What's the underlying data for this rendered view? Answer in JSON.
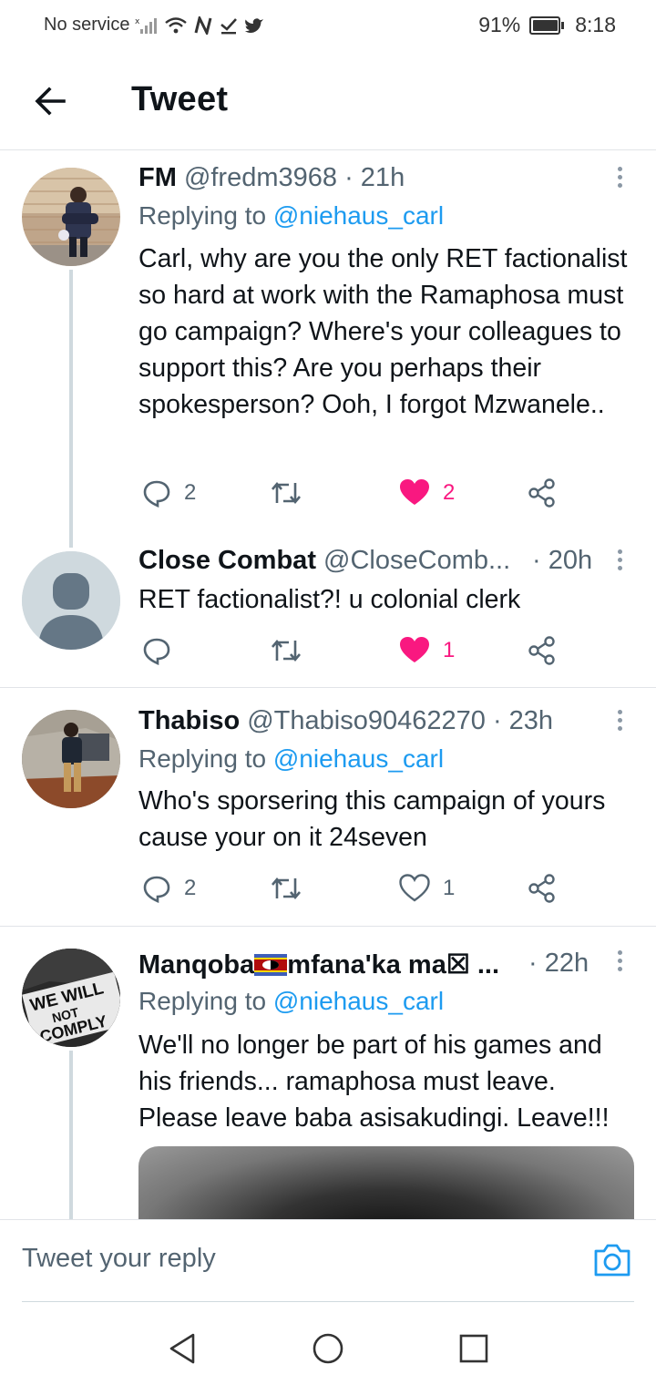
{
  "status_bar": {
    "carrier": "No service",
    "battery": "91%",
    "time": "8:18"
  },
  "header": {
    "title": "Tweet"
  },
  "tweets": [
    {
      "name": "FM",
      "handle": "@fredm3968",
      "time": "· 21h",
      "replying_prefix": "Replying to ",
      "replying_to": "@niehaus_carl",
      "text": "Carl, why are you the only RET factionalist so hard at work with the Ramaphosa must go campaign? Where's your colleagues to support this? Are you perhaps their spokesperson? Ooh, I forgot Mzwanele..",
      "replies": "2",
      "likes": "2"
    },
    {
      "name": "Close Combat",
      "handle": "@CloseComb...",
      "time": "· 20h",
      "text": "RET factionalist?! u colonial clerk",
      "likes": "1"
    },
    {
      "name": "Thabiso",
      "handle": "@Thabiso90462270",
      "time": "· 23h",
      "replying_prefix": "Replying to ",
      "replying_to": "@niehaus_carl",
      "text": "Who's sporsering this campaign of yours cause your on it 24seven",
      "replies": "2",
      "likes": "1"
    },
    {
      "name_part1": "Manqoba",
      "name_part2": "mfana'ka ma☒ ...",
      "time": "· 22h",
      "replying_prefix": "Replying to ",
      "replying_to": "@niehaus_carl",
      "text": "We'll no longer be part of his games and his friends... ramaphosa must leave. Please leave baba asisakudingi. Leave!!!",
      "avatar_text": [
        "WE WILL",
        "NOT",
        "COMPLY"
      ]
    }
  ],
  "reply_bar": {
    "placeholder": "Tweet your reply"
  },
  "colors": {
    "like": "#f91880",
    "link": "#1d9bf0",
    "muted": "#536471"
  },
  "icons": [
    "back-arrow-icon",
    "reply-icon",
    "retweet-icon",
    "heart-icon",
    "share-icon",
    "camera-icon",
    "nav-back-icon",
    "nav-home-icon",
    "nav-recents-icon"
  ]
}
